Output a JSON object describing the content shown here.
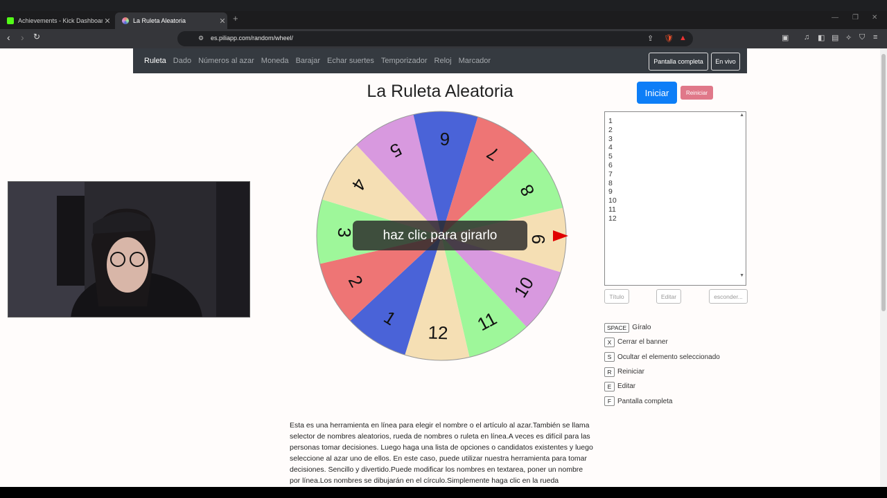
{
  "tabs": [
    {
      "label": "Achievements - Kick Dashboard",
      "icon": "kick-logo-icon"
    },
    {
      "label": "La Ruleta Aleatoria",
      "icon": "piliapp-favicon-icon"
    }
  ],
  "address": {
    "url": "es.piliapp.com/random/wheel/"
  },
  "site_nav": {
    "items": [
      "Ruleta",
      "Dado",
      "Números al azar",
      "Moneda",
      "Barajar",
      "Echar suertes",
      "Temporizador",
      "Reloj",
      "Marcador"
    ],
    "fullscreen_label": "Pantalla completa",
    "live_label": "En vivo"
  },
  "page": {
    "title": "La Ruleta Aleatoria",
    "start_label": "Iniciar",
    "reset_label": "Reiniciar",
    "spin_hint": "haz clic para girarlo"
  },
  "wheel": {
    "labels": [
      "1",
      "2",
      "3",
      "4",
      "5",
      "6",
      "7",
      "8",
      "9",
      "10",
      "11",
      "12"
    ],
    "colors": [
      "#4a63d8",
      "#ee7575",
      "#9ef79a",
      "#f5dfb4",
      "#d899df",
      "#4a63d8",
      "#ee7575",
      "#9ef79a",
      "#f5dfb4",
      "#d899df",
      "#9ef79a",
      "#f5dfb4"
    ],
    "pointer_color": "#e00000"
  },
  "options": {
    "values": [
      "1",
      "2",
      "3",
      "4",
      "5",
      "6",
      "7",
      "8",
      "9",
      "10",
      "11",
      "12"
    ],
    "title_label": "Título",
    "edit_label": "Editar",
    "hide_label": "esconder..."
  },
  "shortcuts": [
    {
      "key": "SPACE",
      "label": "Gíralo"
    },
    {
      "key": "X",
      "label": "Cerrar el banner"
    },
    {
      "key": "S",
      "label": "Ocultar el elemento seleccionado"
    },
    {
      "key": "R",
      "label": "Reiniciar"
    },
    {
      "key": "E",
      "label": "Editar"
    },
    {
      "key": "F",
      "label": "Pantalla completa"
    }
  ],
  "description": "Esta es una herramienta en línea para elegir el nombre o el artículo al azar.También se llama selector de nombres aleatorios, rueda de nombres o ruleta en línea.A veces es difícil para las personas tomar decisiones. Luego haga una lista de opciones o candidatos existentes y luego seleccione al azar uno de ellos. En este caso, puede utilizar nuestra herramienta para tomar decisiones. Sencillo y divertido.Puede modificar los nombres en textarea, poner un nombre por línea.Los nombres se dibujarán en el círculo.Simplemente haga clic en la rueda"
}
